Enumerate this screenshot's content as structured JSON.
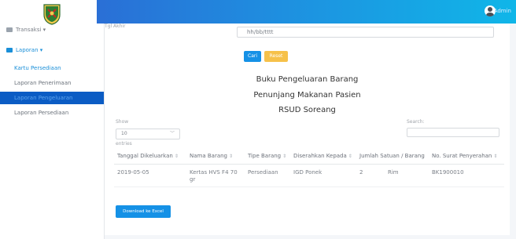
{
  "sidebar": {
    "items": [
      {
        "label": "Transaksi ▾",
        "type": "parent"
      },
      {
        "label": "Laporan ▾",
        "type": "parent-active"
      },
      {
        "label": "Kartu Persediaan",
        "type": "sub-link"
      },
      {
        "label": "Laporan Penerimaan",
        "type": "sub"
      },
      {
        "label": "Laporan Pengeluaran",
        "type": "sub-selected"
      },
      {
        "label": "Laporan Persediaan",
        "type": "sub"
      }
    ]
  },
  "topbar": {
    "user_label": "Admin"
  },
  "filter": {
    "date_label": "Tgl Akhir",
    "date_value": "hh/bb/tttt",
    "cari_label": "Cari",
    "reset_label": "Reset"
  },
  "report": {
    "title1": "Buku Pengeluaran Barang",
    "title2": "Penunjang Makanan Pasien",
    "title3": "RSUD Soreang"
  },
  "datatable": {
    "show_label": "Show",
    "entries_value": "10",
    "entries_label": "entries",
    "search_label": "Search:",
    "columns": [
      {
        "label": "Tanggal Dikeluarkan"
      },
      {
        "label": "Nama Barang"
      },
      {
        "label": "Tipe Barang"
      },
      {
        "label": "Diserahkan Kepada"
      },
      {
        "label": "Jumlah Satuan / Barang"
      },
      {
        "label": "No. Surat Penyerahan"
      }
    ],
    "rows": [
      {
        "tanggal": "2019-05-05",
        "nama": "Kertas HVS F4 70 gr",
        "tipe": "Persediaan",
        "kepada": "IGD Ponek",
        "jumlah": "2",
        "satuan": "Rim",
        "no_surat": "BK1900010"
      }
    ]
  },
  "export": {
    "excel_label": "Download ke Excel"
  },
  "colors": {
    "primary": "#1591e6",
    "warning": "#f6c14a",
    "selected": "#0b5cc4",
    "topbar_start": "#2a6fd6",
    "topbar_end": "#10b6e8"
  }
}
